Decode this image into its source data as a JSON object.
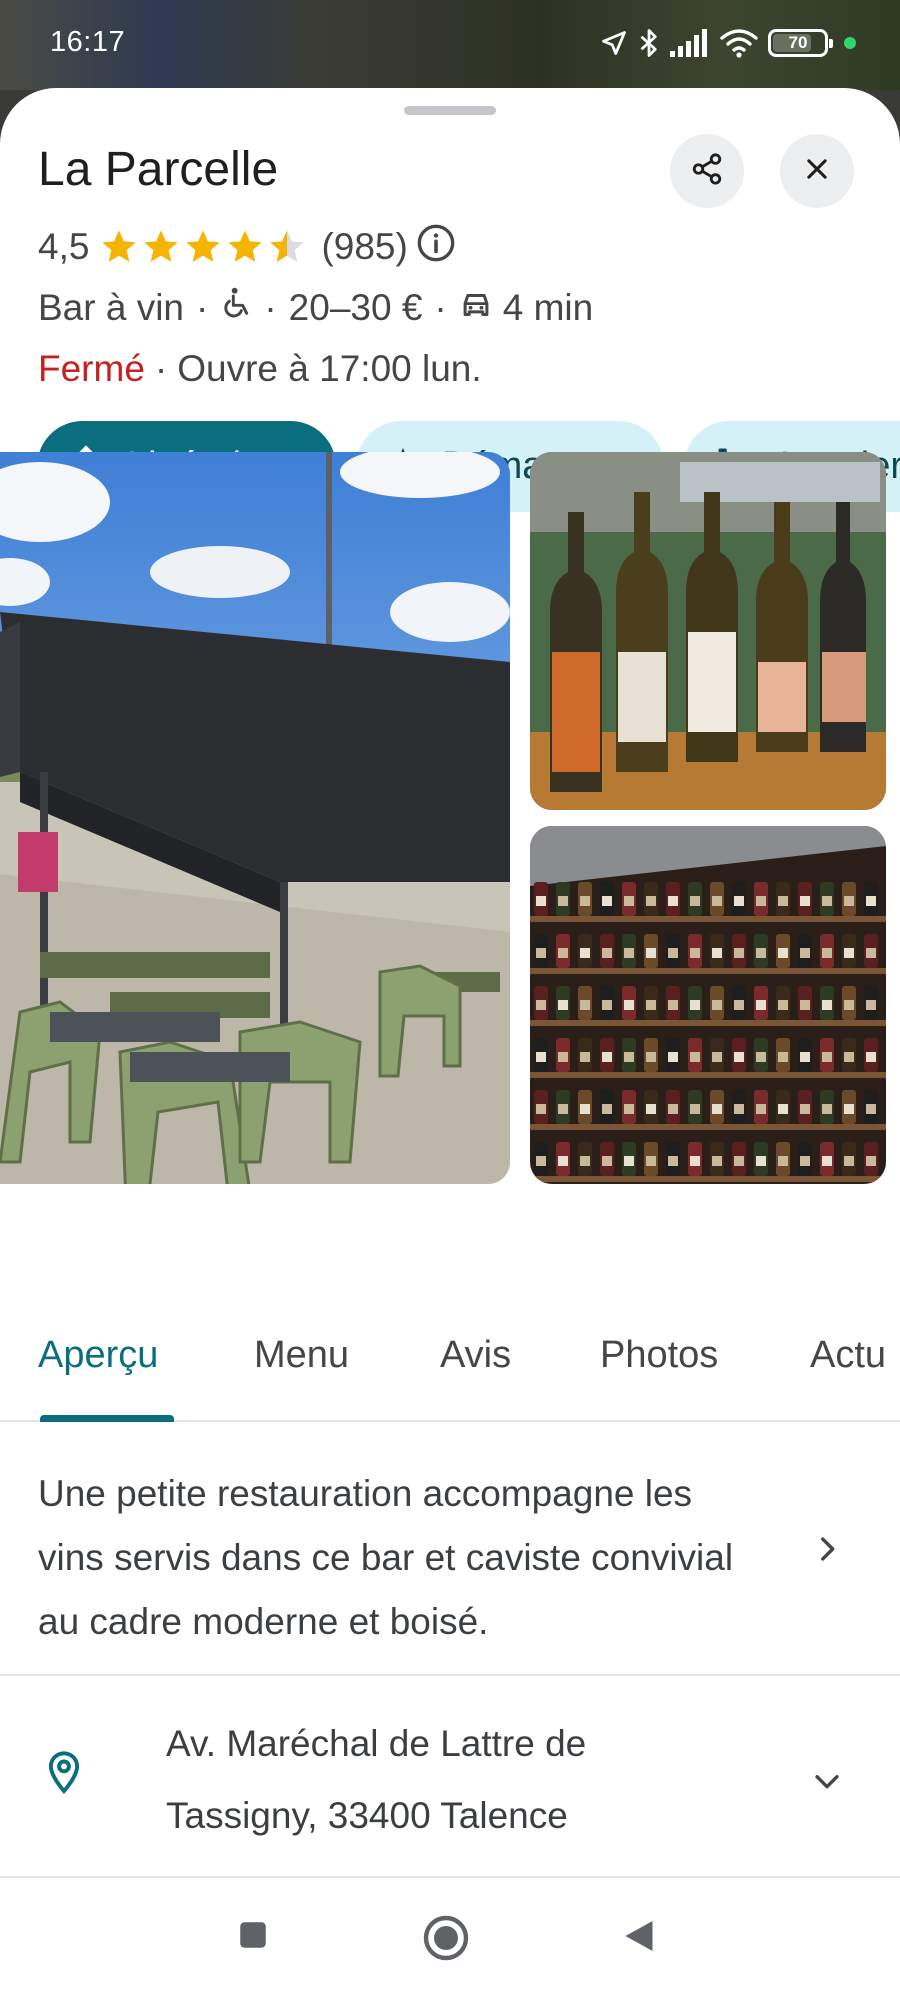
{
  "status_bar": {
    "time": "16:17",
    "battery": "70",
    "icons": [
      "location-arrow-icon",
      "bluetooth-icon",
      "signal-icon",
      "wifi-icon",
      "battery-icon"
    ]
  },
  "place": {
    "name": "La Parcelle",
    "rating": "4,5",
    "rating_stars": 4.5,
    "review_count": "(985)",
    "category": "Bar à vin",
    "separator": "·",
    "price_range": "20–30 €",
    "drive_time": "4 min",
    "status": "Fermé",
    "opens": "Ouvre à 17:00 lun."
  },
  "actions": {
    "directions": "Itinéraire",
    "start": "Démarrer",
    "call": "Appeler"
  },
  "tabs": [
    "Aperçu",
    "Menu",
    "Avis",
    "Photos",
    "Actu"
  ],
  "active_tab": "Aperçu",
  "description": {
    "text": "Une petite restauration accompagne les vins servis dans ce bar et caviste convivial au cadre moderne et boisé."
  },
  "address": {
    "line1": "Av. Maréchal de Lattre de",
    "line2": "Tassigny, 33400 Talence"
  },
  "colors": {
    "accent": "#0b6e7f",
    "chip_secondary": "#d5f1f8",
    "closed_red": "#c5221f",
    "star": "#f5b400"
  }
}
